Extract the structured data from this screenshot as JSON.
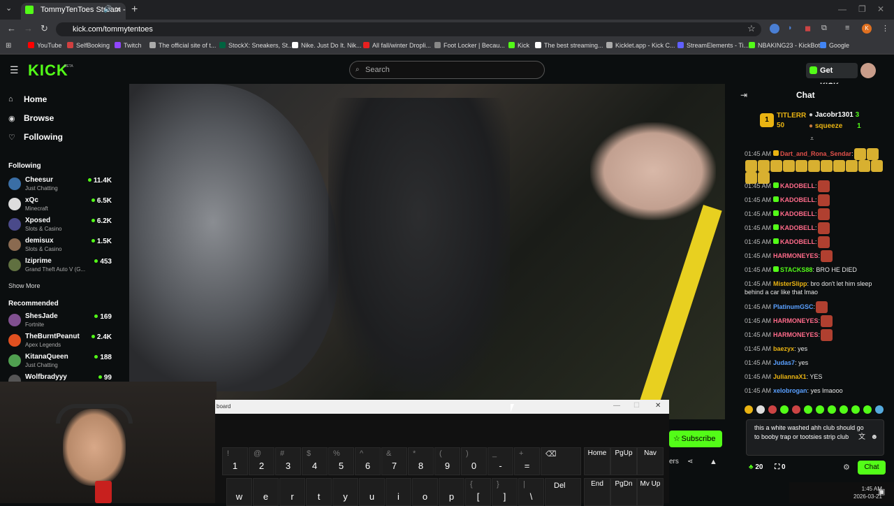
{
  "browser": {
    "tab_title": "TommyTenToes Stream - W",
    "url": "kick.com/tommytentoes",
    "bookmarks": [
      {
        "label": "YouTube",
        "color": "#ff0000"
      },
      {
        "label": "SelfBooking",
        "color": "#d04040"
      },
      {
        "label": "Twitch",
        "color": "#9146ff"
      },
      {
        "label": "The official site of t...",
        "color": "#aaaaaa"
      },
      {
        "label": "StockX: Sneakers, St...",
        "color": "#006340"
      },
      {
        "label": "Nike. Just Do It. Nik...",
        "color": "#ffffff"
      },
      {
        "label": "All fall/winter Dropli...",
        "color": "#e82020"
      },
      {
        "label": "Foot Locker | Becau...",
        "color": "#888888"
      },
      {
        "label": "Kick",
        "color": "#53fc18"
      },
      {
        "label": "The best streaming...",
        "color": "#ffffff"
      },
      {
        "label": "Kicklet.app - Kick C...",
        "color": "#aaaaaa"
      },
      {
        "label": "StreamElements - Ti...",
        "color": "#6060ff"
      },
      {
        "label": "NBAKING23 - KickBot",
        "color": "#53fc18"
      },
      {
        "label": "Google",
        "color": "#4285f4"
      }
    ]
  },
  "header": {
    "logo": "KICK",
    "beta": "BETA",
    "search_placeholder": "Search",
    "get_kicks": "Get KICKs"
  },
  "sidebar": {
    "nav": [
      {
        "label": "Home",
        "icon": "⌂"
      },
      {
        "label": "Browse",
        "icon": "◉"
      },
      {
        "label": "Following",
        "icon": "♡"
      }
    ],
    "following_title": "Following",
    "following": [
      {
        "name": "Cheesur",
        "category": "Just Chatting",
        "viewers": "11.4K",
        "color": "#3a6ea5"
      },
      {
        "name": "xQc",
        "category": "Minecraft",
        "viewers": "6.5K",
        "color": "#dddddd"
      },
      {
        "name": "Xposed",
        "category": "Slots & Casino",
        "viewers": "6.2K",
        "color": "#4a4a8a"
      },
      {
        "name": "demisux",
        "category": "Slots & Casino",
        "viewers": "1.5K",
        "color": "#8a6a50"
      },
      {
        "name": "Iziprime",
        "category": "Grand Theft Auto V (G...",
        "viewers": "453",
        "color": "#607040"
      }
    ],
    "show_more": "Show More",
    "recommended_title": "Recommended",
    "recommended": [
      {
        "name": "ShesJade",
        "category": "Fortnite",
        "viewers": "169",
        "color": "#805090"
      },
      {
        "name": "TheBurntPeanut",
        "category": "Apex Legends",
        "viewers": "2.4K",
        "color": "#e05020"
      },
      {
        "name": "KitanaQueen",
        "category": "Just Chatting",
        "viewers": "188",
        "color": "#50a050"
      },
      {
        "name": "Wolfbradyyy",
        "category": "",
        "viewers": "99",
        "color": "#555555"
      }
    ]
  },
  "chat": {
    "title": "Chat",
    "gift_count": "1",
    "pinned": {
      "user1": "TITLERR",
      "user1_count": "50",
      "user2": "Jacobr1301",
      "user2_count": "3",
      "user3": "squeeze",
      "user3_count": "1"
    },
    "messages": [
      {
        "time": "01:45 AM",
        "user": "Dart_and_Rona_Sendar",
        "color": "#e0504a",
        "text": "",
        "emotes": 15
      },
      {
        "time": "01:45 AM",
        "user": "KADOBELL",
        "color": "#ff6b8a",
        "text": "",
        "emotes": 1
      },
      {
        "time": "01:45 AM",
        "user": "KADOBELL",
        "color": "#ff6b8a",
        "text": "",
        "emotes": 1
      },
      {
        "time": "01:45 AM",
        "user": "KADOBELL",
        "color": "#ff6b8a",
        "text": "",
        "emotes": 1
      },
      {
        "time": "01:45 AM",
        "user": "KADOBELL",
        "color": "#ff6b8a",
        "text": "",
        "emotes": 1
      },
      {
        "time": "01:45 AM",
        "user": "KADOBELL",
        "color": "#ff6b8a",
        "text": "",
        "emotes": 1
      },
      {
        "time": "01:45 AM",
        "user": "HARMONEYES",
        "color": "#ff6b8a",
        "text": "",
        "emotes": 1
      },
      {
        "time": "01:45 AM",
        "user": "STACKS88",
        "color": "#53fc18",
        "text": "BRO HE DIED",
        "emotes": 0
      },
      {
        "time": "01:45 AM",
        "user": "MisterSlipp",
        "color": "#e9b312",
        "text": "bro don't let him sleep behind a car like that lmao",
        "emotes": 0
      },
      {
        "time": "01:45 AM",
        "user": "PlatinumGSC",
        "color": "#5aa0ff",
        "text": "",
        "emotes": 1
      },
      {
        "time": "01:45 AM",
        "user": "HARMONEYES",
        "color": "#ff6b8a",
        "text": "",
        "emotes": 1
      },
      {
        "time": "01:45 AM",
        "user": "HARMONEYES",
        "color": "#ff6b8a",
        "text": "",
        "emotes": 1
      },
      {
        "time": "01:45 AM",
        "user": "baezyx",
        "color": "#e9b312",
        "text": "yes",
        "emotes": 0
      },
      {
        "time": "01:45 AM",
        "user": "Judas7",
        "color": "#5aa0ff",
        "text": "yes",
        "emotes": 0
      },
      {
        "time": "01:45 AM",
        "user": "JuliannaX1",
        "color": "#e9b312",
        "text": "YES",
        "emotes": 0
      },
      {
        "time": "01:45 AM",
        "user": "xelobrogan",
        "color": "#5aa0ff",
        "text": "yes lmaooo",
        "emotes": 0
      }
    ],
    "input_text": "this a white washed ahh club should go to booby trap or tootsies strip club",
    "points": "20",
    "gifts": "0",
    "send": "Chat"
  },
  "stream": {
    "subscribe": "Subscribe",
    "share_suffix": "ers"
  },
  "osk": {
    "title": "board",
    "row1": [
      {
        "up": "!",
        "main": "1"
      },
      {
        "up": "@",
        "main": "2"
      },
      {
        "up": "#",
        "main": "3"
      },
      {
        "up": "$",
        "main": "4"
      },
      {
        "up": "%",
        "main": "5"
      },
      {
        "up": "^",
        "main": "6"
      },
      {
        "up": "&",
        "main": "7"
      },
      {
        "up": "*",
        "main": "8"
      },
      {
        "up": "(",
        "main": "9"
      },
      {
        "up": ")",
        "main": "0"
      },
      {
        "up": "_",
        "main": "-"
      },
      {
        "up": "+",
        "main": "="
      }
    ],
    "row2": [
      {
        "up": "",
        "main": "w"
      },
      {
        "up": "",
        "main": "e"
      },
      {
        "up": "",
        "main": "r"
      },
      {
        "up": "",
        "main": "t"
      },
      {
        "up": "",
        "main": "y"
      },
      {
        "up": "",
        "main": "u"
      },
      {
        "up": "",
        "main": "i"
      },
      {
        "up": "",
        "main": "o"
      },
      {
        "up": "",
        "main": "p"
      },
      {
        "up": "{",
        "main": "["
      },
      {
        "up": "}",
        "main": "]"
      },
      {
        "up": "|",
        "main": "\\"
      }
    ],
    "backspace": "⌫",
    "del": "Del",
    "nav": [
      "Home",
      "PgUp",
      "Nav",
      "End",
      "PgDn",
      "Mv Up"
    ]
  },
  "taskbar": {
    "time": "1:45 AM",
    "date": "2026-03-21"
  }
}
